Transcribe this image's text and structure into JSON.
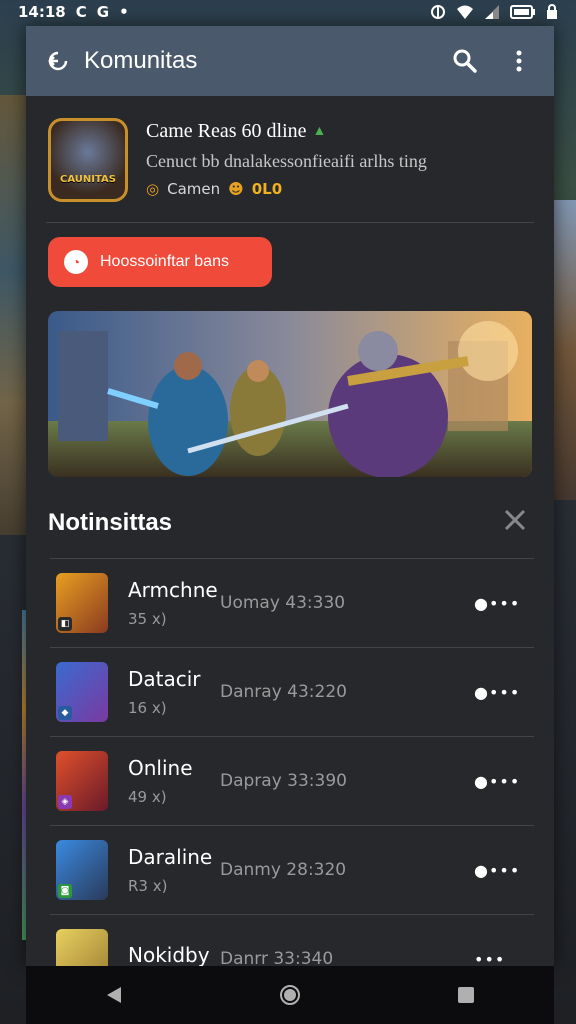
{
  "status_bar": {
    "time": "14:18",
    "notif_icons": [
      "C",
      "G",
      "•"
    ]
  },
  "topbar": {
    "title": "Komunitas"
  },
  "game": {
    "icon_text": "CAUNITAS",
    "title": "Came Reas 60 dline",
    "subtitle": "Cenuct bb dnalakessonfieaifi arlhs ting",
    "meta_label": "Camen",
    "meta_value": "0L0"
  },
  "action_button": {
    "label": "Hoossoinftar bans"
  },
  "notifications": {
    "title": "Notinsittas",
    "items": [
      {
        "name": "Armchne",
        "count": "35 x)",
        "time": "Uomay 43:330"
      },
      {
        "name": "Datacir",
        "count": "16 x)",
        "time": "Danray 43:220"
      },
      {
        "name": "Online",
        "count": "49 x)",
        "time": "Dapray 33:390"
      },
      {
        "name": "Daraline",
        "count": "R3 x)",
        "time": "Danmy 28:320"
      },
      {
        "name": "Nokidby",
        "count": "",
        "time": "Danrr 33:340"
      }
    ]
  },
  "colors": {
    "accent": "#f04a3a",
    "topbar": "#4a5a6c",
    "panel": "#26282c"
  }
}
